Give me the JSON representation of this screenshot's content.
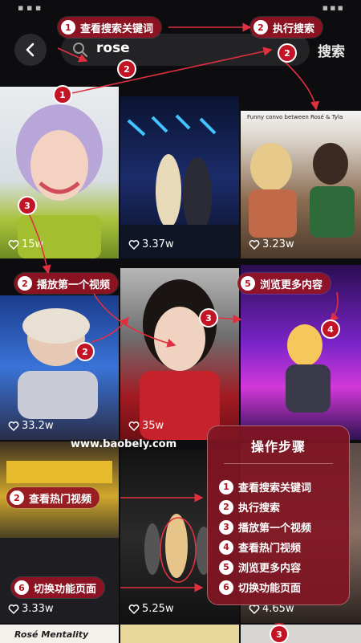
{
  "search": {
    "query": "rose",
    "button_label": "搜索"
  },
  "results": [
    {
      "likes": "15w",
      "caption": ""
    },
    {
      "likes": "3.37w",
      "caption": ""
    },
    {
      "likes": "3.23w",
      "caption": "Funny convo between Rosé & Tyla"
    },
    {
      "likes": "33.2w",
      "caption": ""
    },
    {
      "likes": "35w",
      "caption": ""
    },
    {
      "likes": "",
      "caption": ""
    },
    {
      "likes": "3.33w",
      "caption": ""
    },
    {
      "likes": "5.25w",
      "caption": ""
    },
    {
      "likes": "4.65w",
      "caption": ""
    },
    {
      "likes": "",
      "caption": "Rosé Mentality"
    }
  ],
  "annotations": {
    "view_keyword": "查看搜索关键词",
    "execute_search": "执行搜索",
    "play_first_video": "播放第一个视频",
    "browse_more": "浏览更多内容",
    "view_hot_videos": "查看热门视频",
    "switch_page": "切换功能页面",
    "numbers": [
      "1",
      "2",
      "3",
      "4",
      "5",
      "6"
    ]
  },
  "watermark": "www.baobely.com",
  "steps_panel": {
    "title": "操作步骤",
    "items": [
      {
        "num": "1",
        "text": "查看搜索关键词"
      },
      {
        "num": "2",
        "text": "执行搜索"
      },
      {
        "num": "3",
        "text": "播放第一个视频"
      },
      {
        "num": "4",
        "text": "查看热门视频"
      },
      {
        "num": "5",
        "text": "浏览更多内容"
      },
      {
        "num": "6",
        "text": "切换功能页面"
      }
    ]
  },
  "colors": {
    "accent_red": "#c21424",
    "panel": "#801622"
  },
  "icons": {
    "back": "chevron-left-icon",
    "search": "search-icon",
    "like": "heart-icon"
  }
}
